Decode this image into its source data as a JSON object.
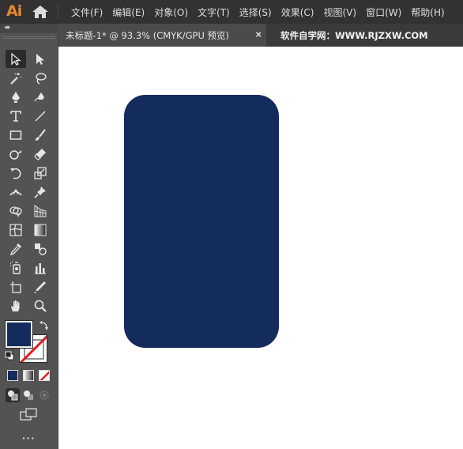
{
  "app": {
    "logo": "Ai",
    "menu": [
      "文件(F)",
      "编辑(E)",
      "对象(O)",
      "文字(T)",
      "选择(S)",
      "效果(C)",
      "视图(V)",
      "窗口(W)",
      "帮助(H)"
    ]
  },
  "tabs": {
    "document": "未标题-1* @ 93.3% (CMYK/GPU 预览)",
    "close": "×",
    "watermark": "软件自学网：WWW.RJZXW.COM"
  },
  "toolbar": {
    "collapse": "◂◂",
    "more": "···",
    "tools": [
      "selection-tool",
      "direct-selection-tool",
      "magic-wand-tool",
      "lasso-tool",
      "pen-tool",
      "curvature-tool",
      "type-tool",
      "line-segment-tool",
      "rectangle-tool",
      "paintbrush-tool",
      "shaper-tool",
      "eraser-tool",
      "rotate-tool",
      "scale-tool",
      "width-tool",
      "puppet-warp-tool",
      "shape-builder-tool",
      "perspective-grid-tool",
      "mesh-tool",
      "gradient-tool",
      "eyedropper-tool",
      "blend-tool",
      "symbol-sprayer-tool",
      "column-graph-tool",
      "artboard-tool",
      "slice-tool",
      "hand-tool",
      "zoom-tool"
    ]
  },
  "colors": {
    "fill": "#142c5c",
    "stroke": "none",
    "menubar_bg": "#323232",
    "toolbar_bg": "#535353",
    "app_accent": "#e8882d"
  },
  "canvas": {
    "shape": "rounded-rectangle",
    "fill": "#142c5c"
  }
}
